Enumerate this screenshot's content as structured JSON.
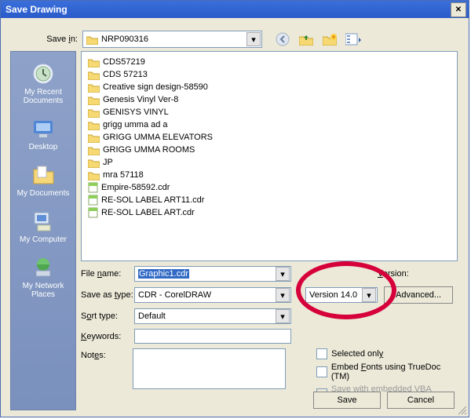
{
  "window": {
    "title": "Save Drawing"
  },
  "toprow": {
    "label": "Save in:",
    "save_in_folder": "NRP090316"
  },
  "sidebar": [
    {
      "key": "recent",
      "label": "My Recent Documents"
    },
    {
      "key": "desktop",
      "label": "Desktop"
    },
    {
      "key": "mydocs",
      "label": "My Documents"
    },
    {
      "key": "mycomputer",
      "label": "My Computer"
    },
    {
      "key": "network",
      "label": "My Network Places"
    }
  ],
  "files": [
    {
      "type": "folder",
      "name": "CDS57219"
    },
    {
      "type": "folder",
      "name": "CDS 57213"
    },
    {
      "type": "folder",
      "name": "Creative sign design-58590"
    },
    {
      "type": "folder",
      "name": "Genesis Vinyl Ver-8"
    },
    {
      "type": "folder",
      "name": "GENISYS VINYL"
    },
    {
      "type": "folder",
      "name": "grigg umma ad a"
    },
    {
      "type": "folder",
      "name": "GRIGG UMMA ELEVATORS"
    },
    {
      "type": "folder",
      "name": "GRIGG UMMA ROOMS"
    },
    {
      "type": "folder",
      "name": "JP"
    },
    {
      "type": "folder",
      "name": "mra 57118"
    },
    {
      "type": "file",
      "name": "Empire-58592.cdr"
    },
    {
      "type": "file",
      "name": "RE-SOL LABEL ART11.cdr"
    },
    {
      "type": "file",
      "name": "RE-SOL LABEL ART.cdr"
    }
  ],
  "form": {
    "filename_label": "File name:",
    "filename_value": "Graphic1.cdr",
    "saveastype_label": "Save as type:",
    "saveastype_value": "CDR - CorelDRAW",
    "sorttype_label": "Sort type:",
    "sorttype_value": "Default",
    "keywords_label": "Keywords:",
    "keywords_value": "",
    "notes_label": "Notes:",
    "notes_value": "",
    "version_label": "Version:",
    "version_value": "Version 14.0",
    "advanced_label": "Advanced...",
    "selected_only": "Selected only",
    "embed_fonts": "Embed Fonts using TrueDoc (TM)",
    "vba_project": "Save with embedded VBA Project"
  },
  "buttons": {
    "save": "Save",
    "cancel": "Cancel"
  }
}
